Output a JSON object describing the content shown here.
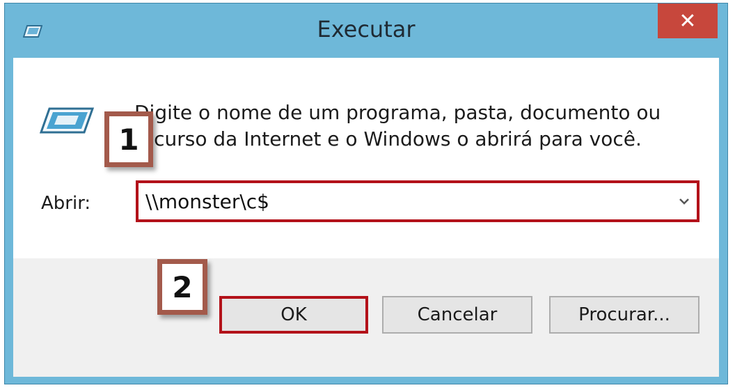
{
  "window": {
    "title": "Executar",
    "close_label": "✕"
  },
  "dialog": {
    "description": "Digite o nome de um programa, pasta, documento ou recurso da Internet e o Windows o abrirá para você.",
    "open_label": "Abrir:",
    "open_value": "\\\\monster\\c$"
  },
  "buttons": {
    "ok": "OK",
    "cancel": "Cancelar",
    "browse": "Procurar..."
  },
  "annotations": {
    "step1": "1",
    "step2": "2",
    "highlight_color": "#b3121a",
    "marker_border_color": "#a35a4b"
  },
  "icons": {
    "title_icon": "run-dialog-icon",
    "app_icon": "run-app-icon",
    "dropdown": "chevron-down-icon"
  },
  "colors": {
    "titlebar": "#6eb8d9",
    "close": "#c7473c"
  }
}
